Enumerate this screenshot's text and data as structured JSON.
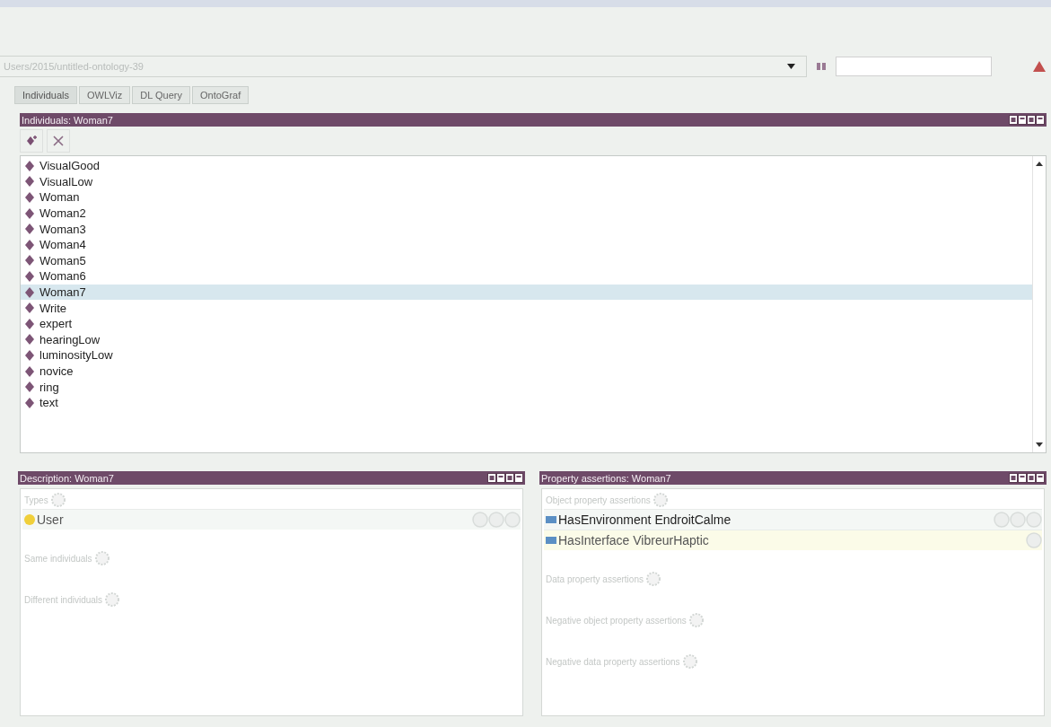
{
  "ontology": {
    "value": "Users/2015/untitled-ontology-39"
  },
  "tabs": [
    {
      "label": "Individuals",
      "selected": true
    },
    {
      "label": "OWLViz",
      "selected": false
    },
    {
      "label": "DL Query",
      "selected": false
    },
    {
      "label": "OntoGraf",
      "selected": false
    }
  ],
  "individuals_panel": {
    "title": "Individuals: Woman7",
    "items": [
      {
        "label": "VisualGood",
        "selected": false
      },
      {
        "label": "VisualLow",
        "selected": false
      },
      {
        "label": "Woman",
        "selected": false
      },
      {
        "label": "Woman2",
        "selected": false
      },
      {
        "label": "Woman3",
        "selected": false
      },
      {
        "label": "Woman4",
        "selected": false
      },
      {
        "label": "Woman5",
        "selected": false
      },
      {
        "label": "Woman6",
        "selected": false
      },
      {
        "label": "Woman7",
        "selected": true
      },
      {
        "label": "Write",
        "selected": false
      },
      {
        "label": "expert",
        "selected": false
      },
      {
        "label": "hearingLow",
        "selected": false
      },
      {
        "label": "luminosityLow",
        "selected": false
      },
      {
        "label": "novice",
        "selected": false
      },
      {
        "label": "ring",
        "selected": false
      },
      {
        "label": "text",
        "selected": false
      }
    ]
  },
  "description_panel": {
    "title": "Description: Woman7",
    "sections": [
      {
        "label": "Types",
        "rows": [
          {
            "label": "User",
            "selected": false
          }
        ]
      },
      {
        "label": "Same individuals"
      },
      {
        "label": "Different individuals"
      }
    ]
  },
  "property_panel": {
    "title": "Property assertions: Woman7",
    "sections": [
      {
        "label": "Object property assertions",
        "rows": [
          {
            "label": "HasEnvironment  EndroitCalme",
            "selected": false
          },
          {
            "label": "HasInterface  VibreurHaptic",
            "selected": true
          }
        ]
      },
      {
        "label": "Data property assertions"
      },
      {
        "label": "Negative object property assertions"
      },
      {
        "label": "Negative data property assertions"
      }
    ]
  }
}
